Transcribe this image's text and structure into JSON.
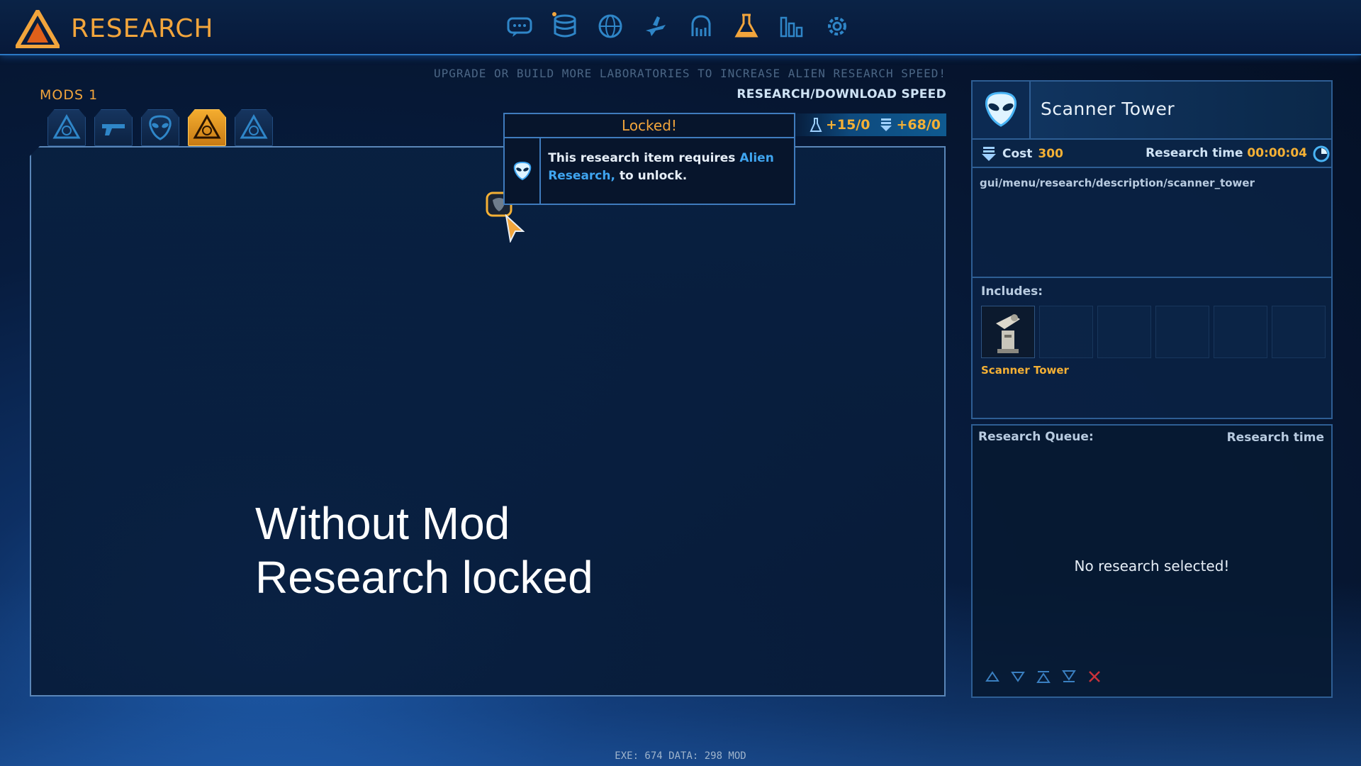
{
  "header": {
    "title": "RESEARCH",
    "nav_icons": [
      "chat-icon",
      "database-icon",
      "globe-icon",
      "aircraft-icon",
      "alien-creature-icon",
      "flask-icon",
      "stats-icon",
      "gear-icon"
    ],
    "active_nav": "flask-icon"
  },
  "hint": "UPGRADE OR BUILD MORE LABORATORIES TO INCREASE ALIEN RESEARCH SPEED!",
  "speed": {
    "label": "RESEARCH/DOWNLOAD SPEED",
    "research": "+15/0",
    "download": "+68/0"
  },
  "mods": {
    "label": "MODS 1",
    "tabs": [
      "base-icon",
      "weapon-icon",
      "alien-icon",
      "base-active-icon",
      "base-icon"
    ],
    "active_index": 3
  },
  "tooltip": {
    "title": "Locked!",
    "text_before": "This research item requires ",
    "link": "Alien Research,",
    "text_after": " to unlock."
  },
  "overlay": {
    "line1": "Without Mod",
    "line2": "Research locked"
  },
  "detail": {
    "name": "Scanner Tower",
    "cost_label": "Cost",
    "cost_value": "300",
    "time_label": "Research time",
    "time_value": "00:00:04",
    "description": "gui/menu/research/description/scanner_tower",
    "includes_label": "Includes:",
    "includes": [
      "Scanner Tower"
    ]
  },
  "queue": {
    "title": "Research Queue:",
    "time_label": "Research time",
    "empty": "No research selected!"
  },
  "footer": "EXE: 674 DATA: 298 MOD",
  "colors": {
    "accent": "#f2a53c",
    "link": "#3fa5f0",
    "border": "#2e5e94"
  }
}
